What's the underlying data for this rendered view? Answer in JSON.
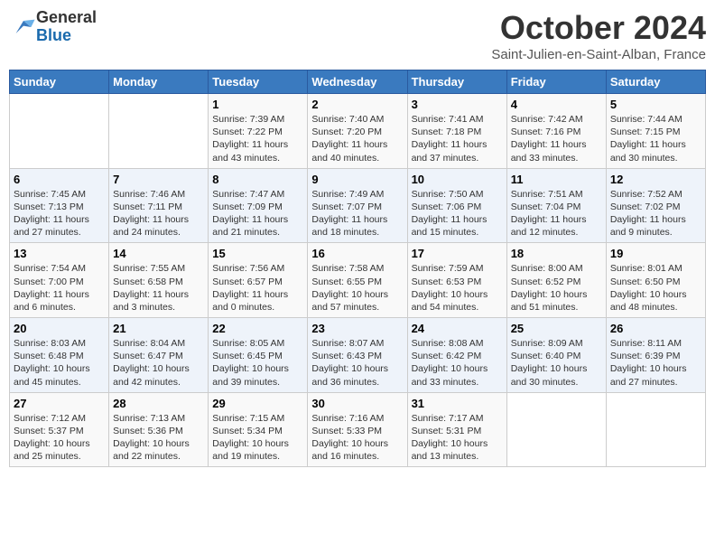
{
  "logo": {
    "general": "General",
    "blue": "Blue"
  },
  "title": "October 2024",
  "location": "Saint-Julien-en-Saint-Alban, France",
  "days_of_week": [
    "Sunday",
    "Monday",
    "Tuesday",
    "Wednesday",
    "Thursday",
    "Friday",
    "Saturday"
  ],
  "weeks": [
    [
      {
        "day": "",
        "sunrise": "",
        "sunset": "",
        "daylight": ""
      },
      {
        "day": "",
        "sunrise": "",
        "sunset": "",
        "daylight": ""
      },
      {
        "day": "1",
        "sunrise": "Sunrise: 7:39 AM",
        "sunset": "Sunset: 7:22 PM",
        "daylight": "Daylight: 11 hours and 43 minutes."
      },
      {
        "day": "2",
        "sunrise": "Sunrise: 7:40 AM",
        "sunset": "Sunset: 7:20 PM",
        "daylight": "Daylight: 11 hours and 40 minutes."
      },
      {
        "day": "3",
        "sunrise": "Sunrise: 7:41 AM",
        "sunset": "Sunset: 7:18 PM",
        "daylight": "Daylight: 11 hours and 37 minutes."
      },
      {
        "day": "4",
        "sunrise": "Sunrise: 7:42 AM",
        "sunset": "Sunset: 7:16 PM",
        "daylight": "Daylight: 11 hours and 33 minutes."
      },
      {
        "day": "5",
        "sunrise": "Sunrise: 7:44 AM",
        "sunset": "Sunset: 7:15 PM",
        "daylight": "Daylight: 11 hours and 30 minutes."
      }
    ],
    [
      {
        "day": "6",
        "sunrise": "Sunrise: 7:45 AM",
        "sunset": "Sunset: 7:13 PM",
        "daylight": "Daylight: 11 hours and 27 minutes."
      },
      {
        "day": "7",
        "sunrise": "Sunrise: 7:46 AM",
        "sunset": "Sunset: 7:11 PM",
        "daylight": "Daylight: 11 hours and 24 minutes."
      },
      {
        "day": "8",
        "sunrise": "Sunrise: 7:47 AM",
        "sunset": "Sunset: 7:09 PM",
        "daylight": "Daylight: 11 hours and 21 minutes."
      },
      {
        "day": "9",
        "sunrise": "Sunrise: 7:49 AM",
        "sunset": "Sunset: 7:07 PM",
        "daylight": "Daylight: 11 hours and 18 minutes."
      },
      {
        "day": "10",
        "sunrise": "Sunrise: 7:50 AM",
        "sunset": "Sunset: 7:06 PM",
        "daylight": "Daylight: 11 hours and 15 minutes."
      },
      {
        "day": "11",
        "sunrise": "Sunrise: 7:51 AM",
        "sunset": "Sunset: 7:04 PM",
        "daylight": "Daylight: 11 hours and 12 minutes."
      },
      {
        "day": "12",
        "sunrise": "Sunrise: 7:52 AM",
        "sunset": "Sunset: 7:02 PM",
        "daylight": "Daylight: 11 hours and 9 minutes."
      }
    ],
    [
      {
        "day": "13",
        "sunrise": "Sunrise: 7:54 AM",
        "sunset": "Sunset: 7:00 PM",
        "daylight": "Daylight: 11 hours and 6 minutes."
      },
      {
        "day": "14",
        "sunrise": "Sunrise: 7:55 AM",
        "sunset": "Sunset: 6:58 PM",
        "daylight": "Daylight: 11 hours and 3 minutes."
      },
      {
        "day": "15",
        "sunrise": "Sunrise: 7:56 AM",
        "sunset": "Sunset: 6:57 PM",
        "daylight": "Daylight: 11 hours and 0 minutes."
      },
      {
        "day": "16",
        "sunrise": "Sunrise: 7:58 AM",
        "sunset": "Sunset: 6:55 PM",
        "daylight": "Daylight: 10 hours and 57 minutes."
      },
      {
        "day": "17",
        "sunrise": "Sunrise: 7:59 AM",
        "sunset": "Sunset: 6:53 PM",
        "daylight": "Daylight: 10 hours and 54 minutes."
      },
      {
        "day": "18",
        "sunrise": "Sunrise: 8:00 AM",
        "sunset": "Sunset: 6:52 PM",
        "daylight": "Daylight: 10 hours and 51 minutes."
      },
      {
        "day": "19",
        "sunrise": "Sunrise: 8:01 AM",
        "sunset": "Sunset: 6:50 PM",
        "daylight": "Daylight: 10 hours and 48 minutes."
      }
    ],
    [
      {
        "day": "20",
        "sunrise": "Sunrise: 8:03 AM",
        "sunset": "Sunset: 6:48 PM",
        "daylight": "Daylight: 10 hours and 45 minutes."
      },
      {
        "day": "21",
        "sunrise": "Sunrise: 8:04 AM",
        "sunset": "Sunset: 6:47 PM",
        "daylight": "Daylight: 10 hours and 42 minutes."
      },
      {
        "day": "22",
        "sunrise": "Sunrise: 8:05 AM",
        "sunset": "Sunset: 6:45 PM",
        "daylight": "Daylight: 10 hours and 39 minutes."
      },
      {
        "day": "23",
        "sunrise": "Sunrise: 8:07 AM",
        "sunset": "Sunset: 6:43 PM",
        "daylight": "Daylight: 10 hours and 36 minutes."
      },
      {
        "day": "24",
        "sunrise": "Sunrise: 8:08 AM",
        "sunset": "Sunset: 6:42 PM",
        "daylight": "Daylight: 10 hours and 33 minutes."
      },
      {
        "day": "25",
        "sunrise": "Sunrise: 8:09 AM",
        "sunset": "Sunset: 6:40 PM",
        "daylight": "Daylight: 10 hours and 30 minutes."
      },
      {
        "day": "26",
        "sunrise": "Sunrise: 8:11 AM",
        "sunset": "Sunset: 6:39 PM",
        "daylight": "Daylight: 10 hours and 27 minutes."
      }
    ],
    [
      {
        "day": "27",
        "sunrise": "Sunrise: 7:12 AM",
        "sunset": "Sunset: 5:37 PM",
        "daylight": "Daylight: 10 hours and 25 minutes."
      },
      {
        "day": "28",
        "sunrise": "Sunrise: 7:13 AM",
        "sunset": "Sunset: 5:36 PM",
        "daylight": "Daylight: 10 hours and 22 minutes."
      },
      {
        "day": "29",
        "sunrise": "Sunrise: 7:15 AM",
        "sunset": "Sunset: 5:34 PM",
        "daylight": "Daylight: 10 hours and 19 minutes."
      },
      {
        "day": "30",
        "sunrise": "Sunrise: 7:16 AM",
        "sunset": "Sunset: 5:33 PM",
        "daylight": "Daylight: 10 hours and 16 minutes."
      },
      {
        "day": "31",
        "sunrise": "Sunrise: 7:17 AM",
        "sunset": "Sunset: 5:31 PM",
        "daylight": "Daylight: 10 hours and 13 minutes."
      },
      {
        "day": "",
        "sunrise": "",
        "sunset": "",
        "daylight": ""
      },
      {
        "day": "",
        "sunrise": "",
        "sunset": "",
        "daylight": ""
      }
    ]
  ]
}
